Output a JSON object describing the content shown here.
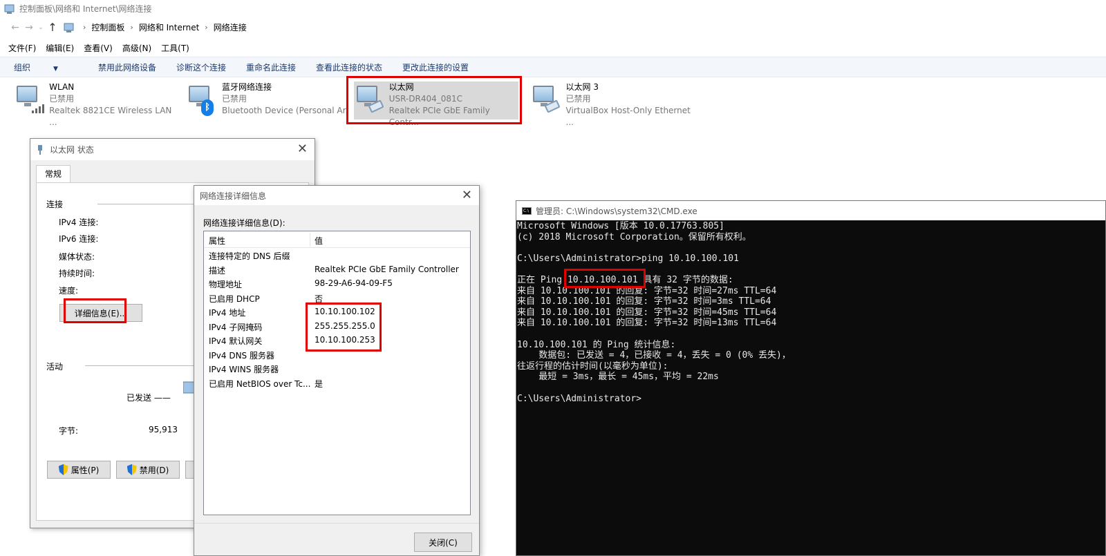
{
  "window": {
    "title": "控制面板\\网络和 Internet\\网络连接"
  },
  "address": {
    "crumbs": [
      "控制面板",
      "网络和 Internet",
      "网络连接"
    ]
  },
  "menu": [
    "文件(F)",
    "编辑(E)",
    "查看(V)",
    "高级(N)",
    "工具(T)"
  ],
  "commands": [
    "组织",
    "禁用此网络设备",
    "诊断这个连接",
    "重命名此连接",
    "查看此连接的状态",
    "更改此连接的设置"
  ],
  "adapters": [
    {
      "name": "WLAN",
      "status": "已禁用",
      "device": "Realtek 8821CE Wireless LAN ..."
    },
    {
      "name": "蓝牙网络连接",
      "status": "已禁用",
      "device": "Bluetooth Device (Personal Ar..."
    },
    {
      "name": "以太网",
      "status": "USR-DR404_081C",
      "device": "Realtek PCIe GbE Family Contr..."
    },
    {
      "name": "以太网 3",
      "status": "已禁用",
      "device": "VirtualBox Host-Only Ethernet ..."
    }
  ],
  "status_dialog": {
    "title": "以太网 状态",
    "tab": "常规",
    "group_connection": "连接",
    "ipv4": "IPv4 连接:",
    "ipv6": "IPv6 连接:",
    "media": "媒体状态:",
    "duration": "持续时间:",
    "speed": "速度:",
    "details_button": "详细信息(E)...",
    "group_activity": "活动",
    "sent": "已发送 ——",
    "bytes_label": "字节:",
    "bytes_value": "95,913",
    "properties_button": "属性(P)",
    "disable_button": "禁用(D)"
  },
  "details_dialog": {
    "title": "网络连接详细信息",
    "list_label": "网络连接详细信息(D):",
    "col_property": "属性",
    "col_value": "值",
    "rows": [
      {
        "p": "连接特定的 DNS 后缀",
        "v": ""
      },
      {
        "p": "描述",
        "v": "Realtek PCIe GbE Family Controller"
      },
      {
        "p": "物理地址",
        "v": "98-29-A6-94-09-F5"
      },
      {
        "p": "已启用 DHCP",
        "v": "否"
      },
      {
        "p": "IPv4 地址",
        "v": "10.10.100.102"
      },
      {
        "p": "IPv4 子网掩码",
        "v": "255.255.255.0"
      },
      {
        "p": "IPv4 默认网关",
        "v": "10.10.100.253"
      },
      {
        "p": "IPv4 DNS 服务器",
        "v": ""
      },
      {
        "p": "IPv4 WINS 服务器",
        "v": ""
      },
      {
        "p": "已启用 NetBIOS over Tc...",
        "v": "是"
      }
    ],
    "close_button": "关闭(C)"
  },
  "cmd": {
    "title": "管理员: C:\\Windows\\system32\\CMD.exe",
    "lines": [
      "Microsoft Windows [版本 10.0.17763.805]",
      "(c) 2018 Microsoft Corporation。保留所有权利。",
      "",
      "C:\\Users\\Administrator>ping 10.10.100.101",
      "",
      "正在 Ping 10.10.100.101 具有 32 字节的数据:",
      "来自 10.10.100.101 的回复: 字节=32 时间=27ms TTL=64",
      "来自 10.10.100.101 的回复: 字节=32 时间=3ms TTL=64",
      "来自 10.10.100.101 的回复: 字节=32 时间=45ms TTL=64",
      "来自 10.10.100.101 的回复: 字节=32 时间=13ms TTL=64",
      "",
      "10.10.100.101 的 Ping 统计信息:",
      "    数据包: 已发送 = 4，已接收 = 4，丢失 = 0 (0% 丢失)，",
      "往返行程的估计时间(以毫秒为单位):",
      "    最短 = 3ms，最长 = 45ms，平均 = 22ms",
      "",
      "C:\\Users\\Administrator>"
    ]
  }
}
